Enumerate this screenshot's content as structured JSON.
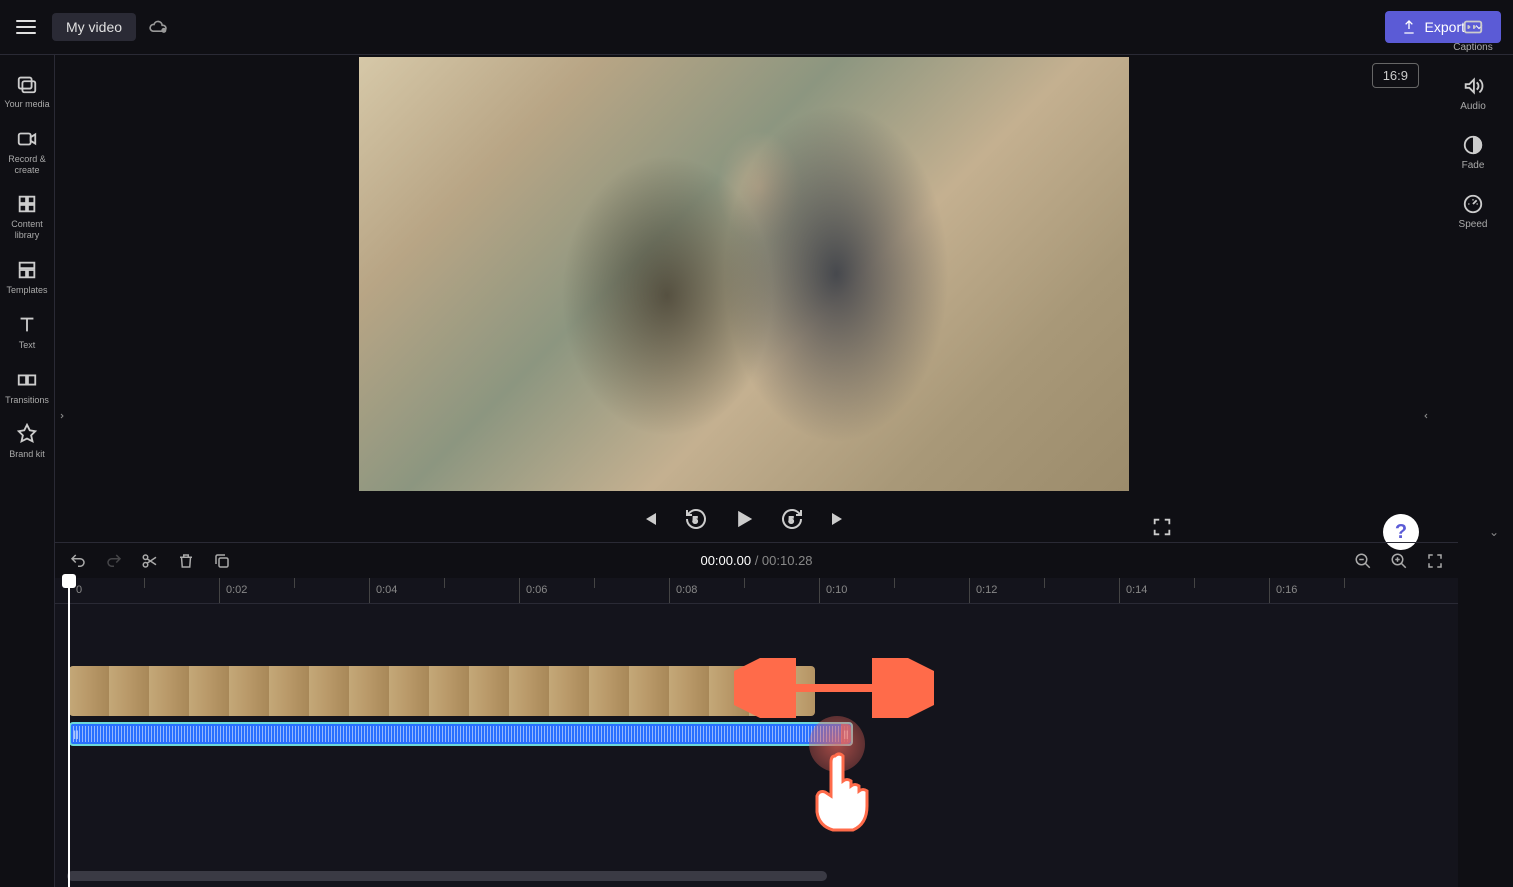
{
  "topbar": {
    "project_name": "My video",
    "export_label": "Export"
  },
  "left_sidebar": {
    "items": [
      {
        "icon": "media",
        "label": "Your media"
      },
      {
        "icon": "record",
        "label": "Record & create"
      },
      {
        "icon": "library",
        "label": "Content library"
      },
      {
        "icon": "templates",
        "label": "Templates"
      },
      {
        "icon": "text",
        "label": "Text"
      },
      {
        "icon": "transitions",
        "label": "Transitions"
      },
      {
        "icon": "brandkit",
        "label": "Brand kit"
      }
    ]
  },
  "right_sidebar": {
    "items": [
      {
        "icon": "captions",
        "label": "Captions"
      },
      {
        "icon": "audio",
        "label": "Audio"
      },
      {
        "icon": "fade",
        "label": "Fade"
      },
      {
        "icon": "speed",
        "label": "Speed"
      }
    ]
  },
  "preview": {
    "aspect_ratio": "16:9",
    "help_label": "?"
  },
  "timeline": {
    "current_time": "00:00.00",
    "separator": " / ",
    "total_time": "00:10.28",
    "ticks": [
      "0",
      "0:02",
      "0:04",
      "0:06",
      "0:08",
      "0:10",
      "0:12",
      "0:14",
      "0:16"
    ]
  }
}
